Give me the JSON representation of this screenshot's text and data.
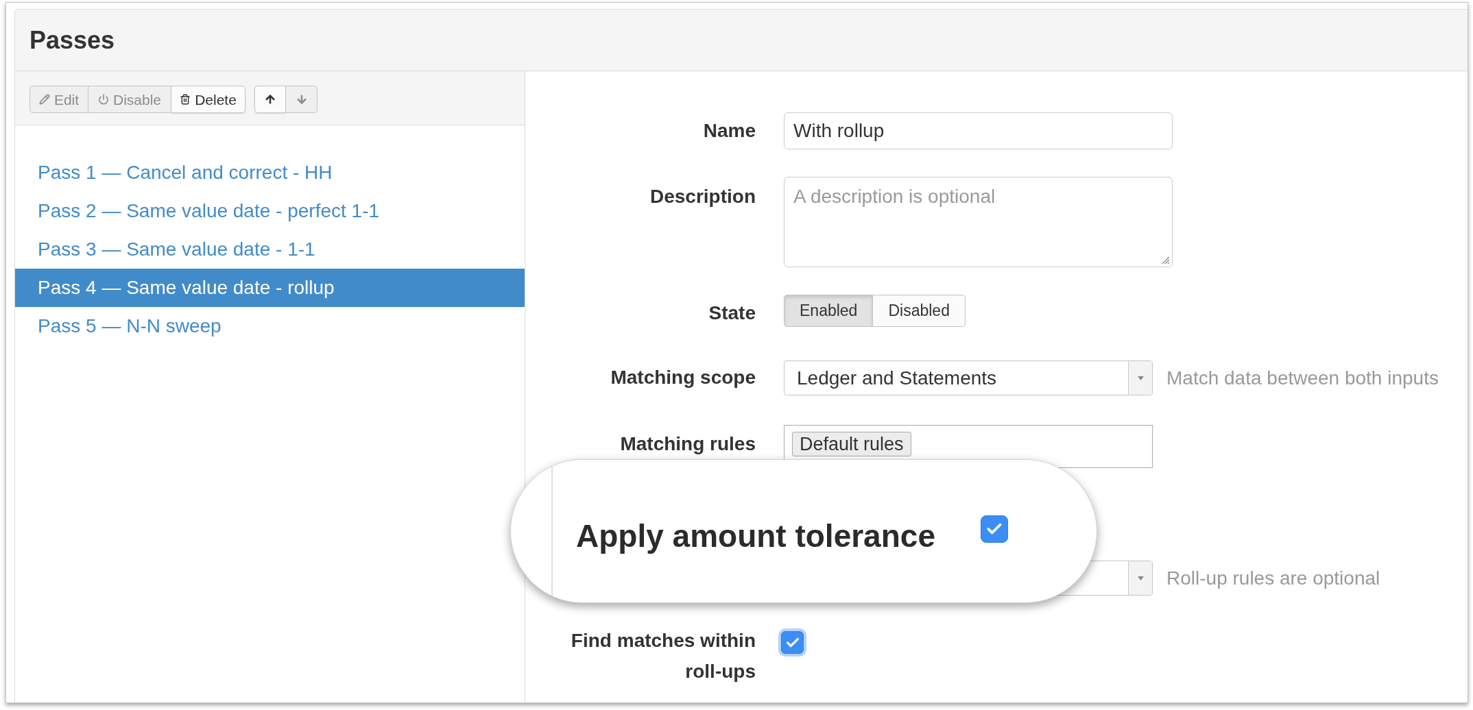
{
  "panel": {
    "title": "Passes"
  },
  "toolbar": {
    "edit": {
      "label": "Edit",
      "disabled": true
    },
    "disable": {
      "label": "Disable",
      "disabled": true
    },
    "delete": {
      "label": "Delete",
      "disabled": false
    },
    "move_up": {
      "disabled": false
    },
    "move_down": {
      "disabled": true
    }
  },
  "passes": [
    {
      "label": "Pass 1 — Cancel and correct - HH",
      "selected": false
    },
    {
      "label": "Pass 2 — Same value date - perfect 1-1",
      "selected": false
    },
    {
      "label": "Pass 3 — Same value date - 1-1",
      "selected": false
    },
    {
      "label": "Pass 4 — Same value date - rollup",
      "selected": true
    },
    {
      "label": "Pass 5 — N-N sweep",
      "selected": false
    }
  ],
  "form": {
    "name": {
      "label": "Name",
      "value": "With rollup"
    },
    "description": {
      "label": "Description",
      "placeholder": "A description is optional"
    },
    "state": {
      "label": "State",
      "options": [
        {
          "label": "Enabled",
          "selected": true
        },
        {
          "label": "Disabled",
          "selected": false
        }
      ]
    },
    "matching_scope": {
      "label": "Matching scope",
      "value": "Ledger and Statements",
      "help": "Match data between both inputs"
    },
    "matching_rules": {
      "label": "Matching rules",
      "tags": [
        "Default rules"
      ]
    },
    "rollup_rules": {
      "help": "Roll-up rules are optional"
    },
    "find_matches": {
      "label": "Find matches within roll-ups",
      "checked": true
    }
  },
  "callout": {
    "label": "Apply amount tolerance",
    "checked": true
  }
}
